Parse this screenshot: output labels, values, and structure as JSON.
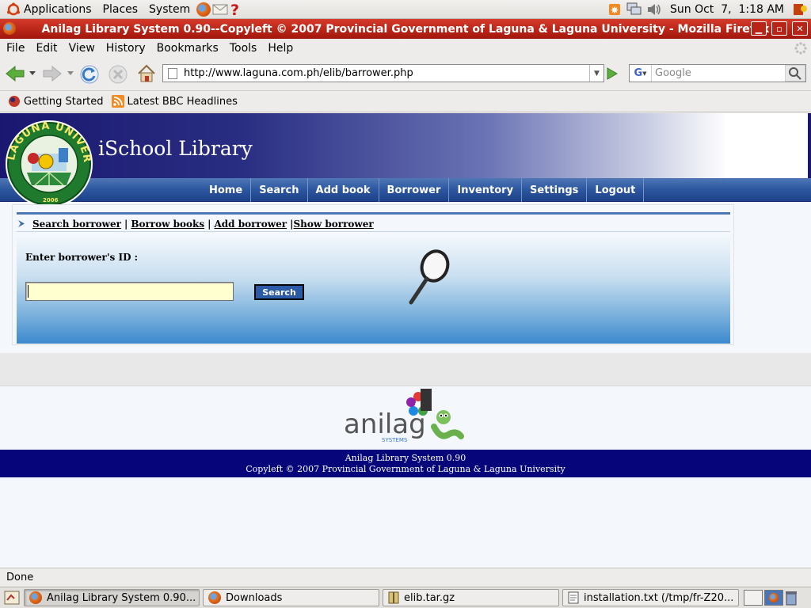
{
  "gnome_panel": {
    "menus": [
      "Applications",
      "Places",
      "System"
    ],
    "clock": "Sun Oct  7,  1:18 AM"
  },
  "window": {
    "title": "Anilag Library System 0.90--Copyleft © 2007 Provincial Government of Laguna & Laguna University - Mozilla Firefox"
  },
  "menubar": [
    "File",
    "Edit",
    "View",
    "History",
    "Bookmarks",
    "Tools",
    "Help"
  ],
  "navbar": {
    "url": "http://www.laguna.com.ph/elib/barrower.php",
    "search_placeholder": "Google"
  },
  "bookmarks": [
    "Getting Started",
    "Latest BBC Headlines"
  ],
  "site": {
    "logo_text": "LAGUNA UNIVERSITY",
    "logo_year": "2006",
    "name": "iSchool Library",
    "nav": [
      "Home",
      "Search",
      "Add book",
      "Borrower",
      "Inventory",
      "Settings",
      "Logout"
    ],
    "sublinks": [
      "Search borrower",
      "Borrow books",
      "Add borrower",
      "Show borrower"
    ],
    "form": {
      "label": "Enter borrower's ID :",
      "input_value": "",
      "button": "Search"
    },
    "anilag_brand": "anilag",
    "anilag_sub": "SYSTEMS",
    "footer_line1": "Anilag Library System 0.90",
    "footer_line2": "Copyleft © 2007 Provincial Government of Laguna & Laguna University"
  },
  "status": "Done",
  "taskbar": [
    "Anilag Library System 0.90...",
    "Downloads",
    "elib.tar.gz",
    "installation.txt (/tmp/fr-Z20..."
  ]
}
